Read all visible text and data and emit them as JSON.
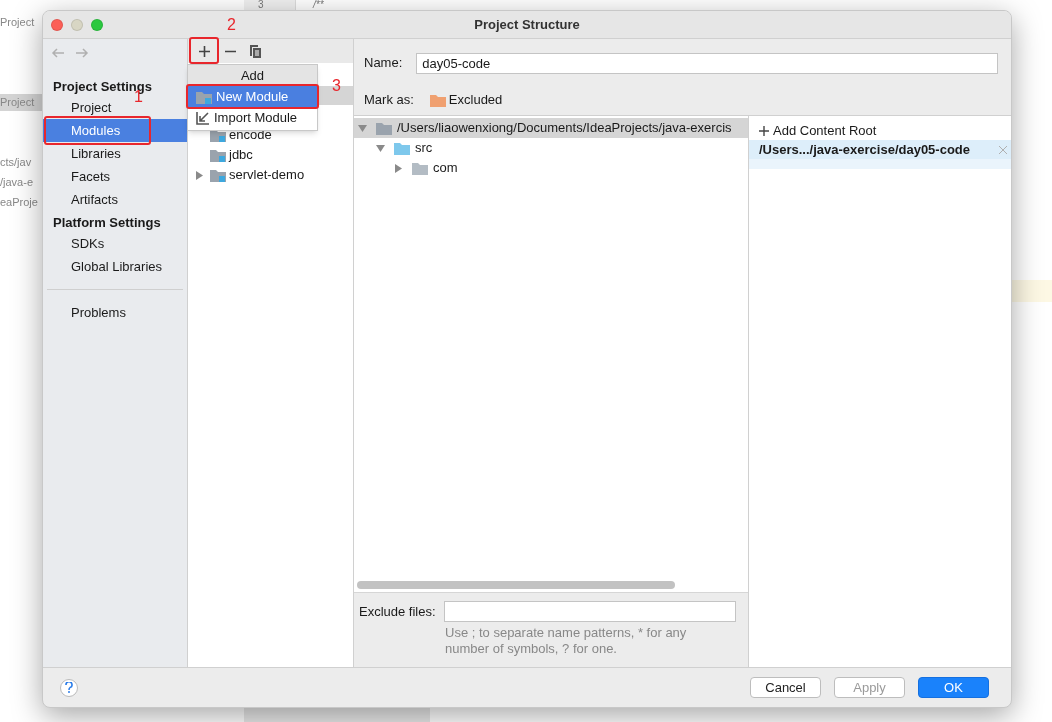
{
  "background": {
    "gutter": {
      "line_number": "3",
      "code": "/**"
    },
    "left_texts": [
      {
        "text": "Project",
        "selected": false
      },
      {
        "text": "Project",
        "selected": true
      },
      {
        "text": "cts/jav",
        "selected": false
      },
      {
        "text": "/java-e",
        "selected": false
      },
      {
        "text": "eaProje",
        "selected": false
      }
    ]
  },
  "window": {
    "title": "Project Structure"
  },
  "sidebar": {
    "sections": [
      {
        "heading": "Project Settings",
        "items": [
          {
            "label": "Project",
            "selected": false
          },
          {
            "label": "Modules",
            "selected": true
          },
          {
            "label": "Libraries",
            "selected": false
          },
          {
            "label": "Facets",
            "selected": false
          },
          {
            "label": "Artifacts",
            "selected": false
          }
        ]
      },
      {
        "heading": "Platform Settings",
        "items": [
          {
            "label": "SDKs",
            "selected": false
          },
          {
            "label": "Global Libraries",
            "selected": false
          }
        ]
      }
    ],
    "footer_items": [
      {
        "label": "Problems",
        "selected": false
      }
    ]
  },
  "modules": [
    {
      "name": "encode",
      "expandable": false
    },
    {
      "name": "jdbc",
      "expandable": false
    },
    {
      "name": "servlet-demo",
      "expandable": true
    }
  ],
  "add_menu": {
    "header": "Add",
    "items": [
      {
        "label": "New Module",
        "kind": "new",
        "selected": true
      },
      {
        "label": "Import Module",
        "kind": "import",
        "selected": false
      }
    ]
  },
  "name_field": {
    "label": "Name:",
    "value": "day05-code"
  },
  "mark_as": {
    "label": "Mark as:",
    "options": [
      {
        "label": "Excluded",
        "color": "#f0a070"
      }
    ]
  },
  "tree": {
    "label": "/Users/liaowenxiong/Documents/IdeaProjects/java-exercis",
    "expanded": true,
    "selected": true,
    "kind": "root",
    "children": [
      {
        "label": "src",
        "expanded": true,
        "selected": false,
        "kind": "source",
        "children": [
          {
            "label": "com",
            "expanded": false,
            "selected": false,
            "kind": "package"
          }
        ]
      }
    ]
  },
  "content_roots": {
    "add_label": "Add Content Root",
    "roots": [
      {
        "path": "/Users.../java-exercise/day05-code",
        "selected": true
      }
    ]
  },
  "exclude": {
    "label": "Exclude files:",
    "hint": "Use ; to separate name patterns, * for any number of symbols, ? for one."
  },
  "buttons": [
    {
      "label": "Cancel",
      "kind": "normal",
      "disabled": false
    },
    {
      "label": "Apply",
      "kind": "normal",
      "disabled": true
    },
    {
      "label": "OK",
      "kind": "default",
      "disabled": false
    }
  ],
  "annotations": [
    "1",
    "2",
    "3"
  ]
}
